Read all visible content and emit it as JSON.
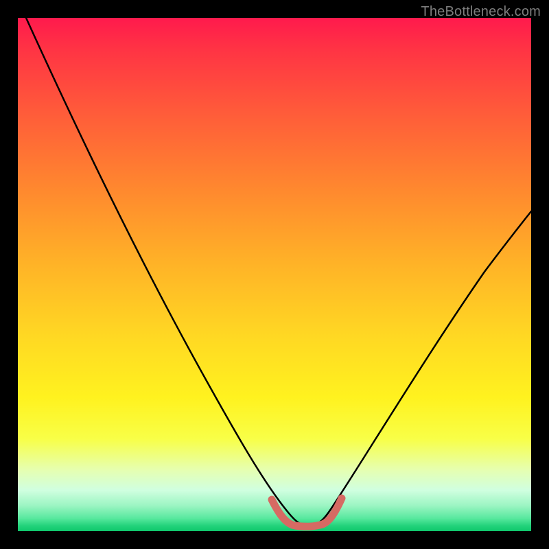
{
  "watermark": "TheBottleneck.com",
  "chart_data": {
    "type": "line",
    "title": "",
    "xlabel": "",
    "ylabel": "",
    "xlim": [
      0,
      100
    ],
    "ylim": [
      0,
      100
    ],
    "grid": false,
    "legend": false,
    "series": [
      {
        "name": "bottleneck-curve",
        "color": "#000000",
        "x": [
          2,
          10,
          20,
          30,
          40,
          48,
          52,
          55,
          58,
          60,
          62,
          66,
          74,
          84,
          94,
          100
        ],
        "y": [
          100,
          84,
          65,
          47,
          28,
          12,
          5,
          2,
          2,
          4,
          9,
          20,
          35,
          50,
          62,
          69
        ]
      },
      {
        "name": "bottleneck-highlight",
        "color": "#d66a63",
        "x": [
          47,
          50,
          52,
          54,
          56,
          58,
          60,
          62
        ],
        "y": [
          10,
          4,
          2,
          2,
          2,
          2,
          4,
          9
        ]
      }
    ],
    "background_gradient": {
      "top": "#ff1a4d",
      "mid": "#ffe423",
      "bottom": "#0fc86c"
    }
  }
}
